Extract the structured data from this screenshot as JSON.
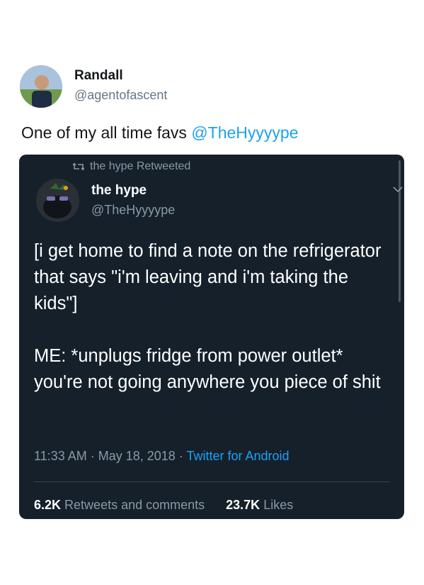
{
  "outer_tweet": {
    "name": "Randall",
    "handle": "@agentofascent",
    "text_prefix": "One of my all time favs ",
    "text_mention": "@TheHyyyype"
  },
  "embedded_tweet": {
    "retweet_label": "the hype Retweeted",
    "name": "the hype",
    "handle": "@TheHyyyype",
    "body": "[i get home to find a note on the refrigerator that says \"i'm leaving and i'm taking the kids\"]\n\nME: *unplugs fridge from power outlet* you're not going anywhere you piece of shit",
    "time": "11:33 AM",
    "separator": " · ",
    "date": "May 18, 2018",
    "client": "Twitter for Android",
    "retweets_count": "6.2K",
    "retweets_label": "Retweets and comments",
    "likes_count": "23.7K",
    "likes_label": "Likes"
  },
  "colors": {
    "card_bg": "#15202b",
    "link_blue": "#1da1f2",
    "muted": "#8899a6"
  },
  "icons": [
    "retweet-icon",
    "chevron-down-icon"
  ]
}
